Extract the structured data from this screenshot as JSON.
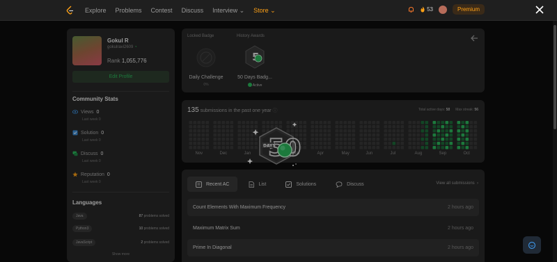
{
  "nav": {
    "links": [
      "Explore",
      "Problems",
      "Contest",
      "Discuss",
      "Interview ⌄",
      "Store ⌄"
    ],
    "streak_count": "53",
    "premium_label": "Premium"
  },
  "profile": {
    "name": "Gokul R",
    "username": "gokulravi2609",
    "rank_label": "Rank",
    "rank_value": "1,055,776",
    "edit_label": "Edit Profile"
  },
  "community": {
    "title": "Community Stats",
    "stats": [
      {
        "label": "Views",
        "value": "0",
        "sub": "Last week 0",
        "icon": "eye-icon",
        "color": "#3d8fdc"
      },
      {
        "label": "Solution",
        "value": "0",
        "sub": "Last week 0",
        "icon": "check-square-icon",
        "color": "#3d8fdc"
      },
      {
        "label": "Discuss",
        "value": "0",
        "sub": "Last week 0",
        "icon": "chat-icon",
        "color": "#2cbb5d"
      },
      {
        "label": "Reputation",
        "value": "0",
        "sub": "Last week 0",
        "icon": "star-icon",
        "color": "#ffa116"
      }
    ]
  },
  "languages": {
    "title": "Languages",
    "items": [
      {
        "name": "Java",
        "count": "87",
        "suffix": "problems solved"
      },
      {
        "name": "Python3",
        "count": "10",
        "suffix": "problems solved"
      },
      {
        "name": "JavaScript",
        "count": "2",
        "suffix": "problems solved"
      }
    ],
    "show_more": "Show more"
  },
  "badges": {
    "locked_title": "Locked Badge",
    "history_title": "History Awards",
    "locked_name": "Daily Challenge",
    "locked_progress": "0%",
    "award_name": "50 Days Badg...",
    "award_status": "Active"
  },
  "heatmap": {
    "count": "135",
    "title_suffix": "submissions in the past one year",
    "active_days_label": "Total active days:",
    "active_days": "58",
    "max_streak_label": "Max streak:",
    "max_streak": "56",
    "months": [
      "Nov",
      "Dec",
      "Jan",
      "Feb",
      "Mar",
      "Apr",
      "May",
      "Jun",
      "Jul",
      "Aug",
      "Sep",
      "Oct"
    ]
  },
  "overlay_badge": {
    "label": "DAYS",
    "number": "50"
  },
  "recent": {
    "tabs": [
      "Recent AC",
      "List",
      "Solutions",
      "Discuss"
    ],
    "view_all": "View all submissions",
    "rows": [
      {
        "title": "Count Elements With Maximum Frequency",
        "time": "2 hours ago"
      },
      {
        "title": "Maximum Matrix Sum",
        "time": "2 hours ago"
      },
      {
        "title": "Prime In Diagonal",
        "time": "2 hours ago"
      }
    ]
  }
}
